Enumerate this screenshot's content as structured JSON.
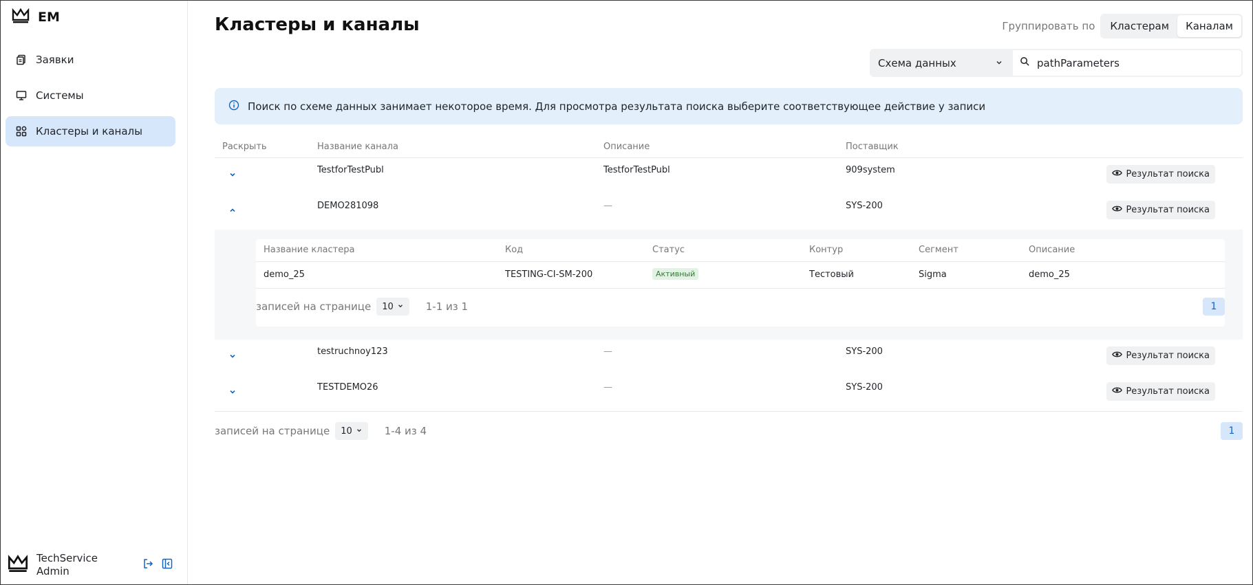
{
  "app": {
    "brand": "EM"
  },
  "sidebar": {
    "items": [
      {
        "label": "Заявки",
        "icon": "documents-icon"
      },
      {
        "label": "Системы",
        "icon": "monitor-icon"
      },
      {
        "label": "Кластеры и каналы",
        "icon": "grid-icon"
      }
    ],
    "user": {
      "name": "TechService Admin"
    }
  },
  "header": {
    "title": "Кластеры и каналы",
    "group_label": "Группировать по",
    "group_options": [
      "Кластерам",
      "Каналам"
    ],
    "group_selected": "Каналам"
  },
  "filters": {
    "scheme_select": "Схема данных",
    "search_value": "pathParameters"
  },
  "info": {
    "text": "Поиск по схеме данных занимает некоторое время. Для просмотра результата поиска выберите соответствующее действие у записи"
  },
  "table": {
    "columns": [
      "Раскрыть",
      "Название канала",
      "Описание",
      "Поставщик"
    ],
    "action_label": "Результат поиска",
    "rows": [
      {
        "name": "TestforTestPubl",
        "desc": "TestforTestPubl",
        "provider": "909system",
        "expanded": false
      },
      {
        "name": "DEMO281098",
        "desc": "—",
        "provider": "SYS-200",
        "expanded": true
      },
      {
        "name": "testruchnoy123",
        "desc": "—",
        "provider": "SYS-200",
        "expanded": false
      },
      {
        "name": "TESTDEMO26",
        "desc": "—",
        "provider": "SYS-200",
        "expanded": false
      }
    ],
    "sub": {
      "columns": [
        "Название кластера",
        "Код",
        "Статус",
        "Контур",
        "Сегмент",
        "Описание"
      ],
      "rows": [
        {
          "name": "demo_25",
          "code": "TESTING-CI-SM-200",
          "status": "Активный",
          "contour": "Тестовый",
          "segment": "Sigma",
          "desc": "demo_25"
        }
      ],
      "pager": {
        "label": "записей на странице",
        "size": "10",
        "range": "1-1 из 1",
        "page": "1"
      }
    },
    "pager": {
      "label": "записей на странице",
      "size": "10",
      "range": "1-4 из 4",
      "page": "1"
    }
  }
}
